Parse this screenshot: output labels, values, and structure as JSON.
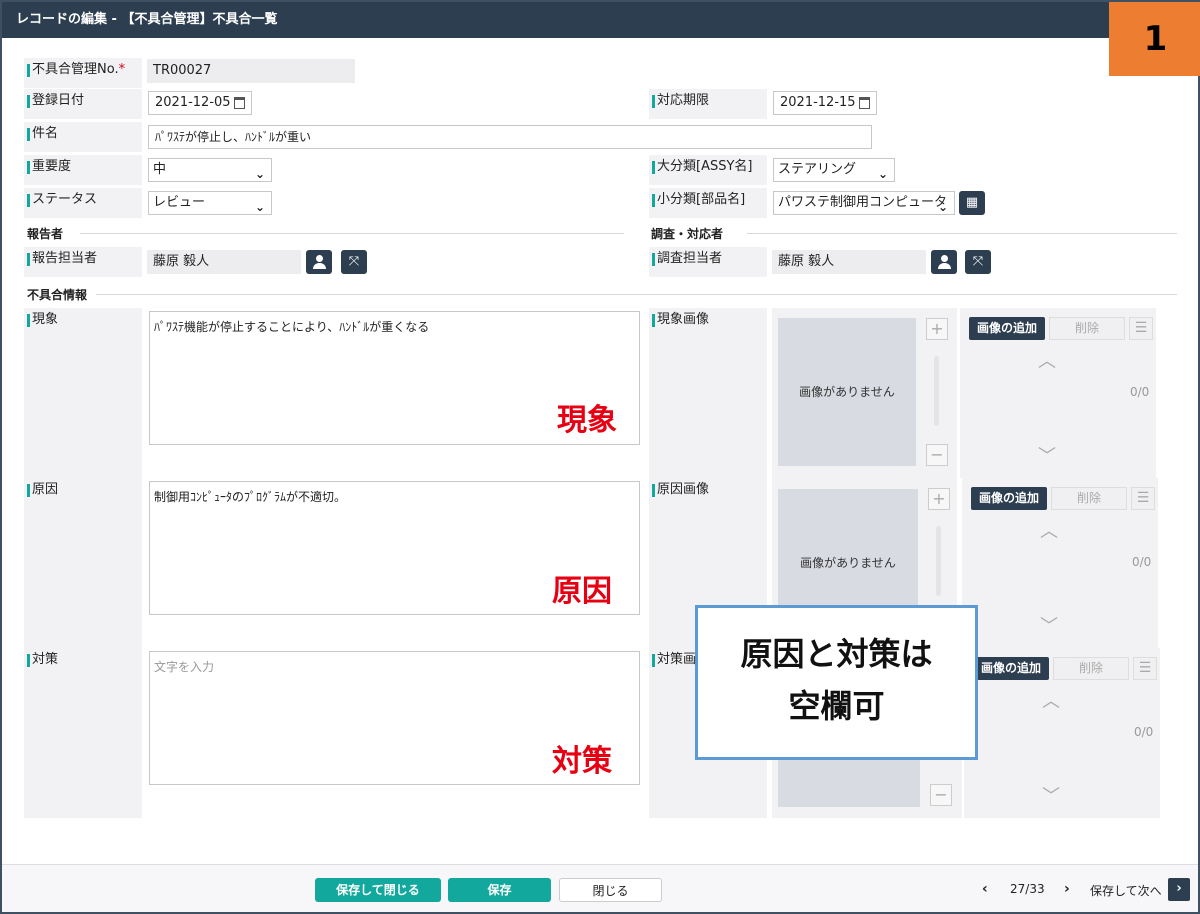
{
  "window": {
    "title": "レコードの編集 - 【不具合管理】不具合一覧"
  },
  "badge": "1",
  "fields": {
    "no": {
      "label": "不具合管理No.",
      "required_mark": "*",
      "value": "TR00027"
    },
    "reg_date": {
      "label": "登録日付",
      "value": "2021-12-05"
    },
    "deadline": {
      "label": "対応期限",
      "value": "2021-12-15"
    },
    "subject": {
      "label": "件名",
      "value": "ﾊﾟﾜｽﾃが停止し、ﾊﾝﾄﾞﾙが重い"
    },
    "severity": {
      "label": "重要度",
      "value": "中"
    },
    "category": {
      "label": "大分類[ASSY名]",
      "value": "ステアリング"
    },
    "status": {
      "label": "ステータス",
      "value": "レビュー"
    },
    "subcategory": {
      "label": "小分類[部品名]",
      "value": "パワステ制御用コンピュータ"
    }
  },
  "sections": {
    "reporter": "報告者",
    "investigator": "調査・対応者",
    "info": "不具合情報"
  },
  "reporter": {
    "label": "報告担当者",
    "value": "藤原 毅人"
  },
  "investigator": {
    "label": "調査担当者",
    "value": "藤原 毅人"
  },
  "phenomenon": {
    "label": "現象",
    "value": "ﾊﾟﾜｽﾃ機能が停止することにより、ﾊﾝﾄﾞﾙが重くなる",
    "overlay": "現象",
    "image_label": "現象画像"
  },
  "cause": {
    "label": "原因",
    "value": "制御用ｺﾝﾋﾟｭｰﾀのﾌﾟﾛｸﾞﾗﾑが不適切。",
    "overlay": "原因",
    "image_label": "原因画像"
  },
  "measure": {
    "label": "対策",
    "placeholder": "文字を入力",
    "overlay": "対策",
    "image_label": "対策画"
  },
  "image_panel": {
    "no_image": "画像がありません",
    "add": "画像の追加",
    "delete": "削除",
    "count": "0/0"
  },
  "callout": {
    "line1": "原因と対策は",
    "line2": "空欄可"
  },
  "footer": {
    "save_close": "保存して閉じる",
    "save": "保存",
    "close": "閉じる",
    "page": "27/33",
    "save_next": "保存して次へ"
  }
}
